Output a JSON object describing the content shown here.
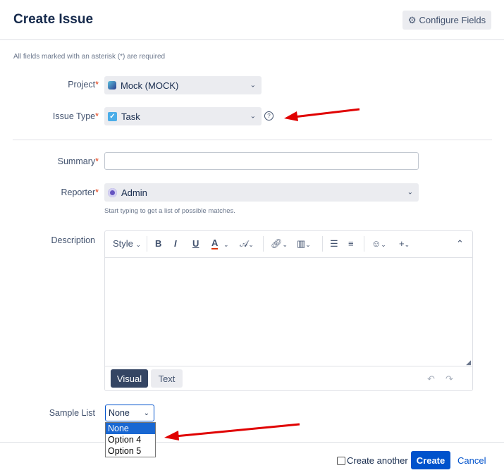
{
  "header": {
    "title": "Create Issue",
    "configure_label": "Configure Fields"
  },
  "required_note": "All fields marked with an asterisk (*) are required",
  "project": {
    "label": "Project",
    "value": "Mock (MOCK)"
  },
  "issue_type": {
    "label": "Issue Type",
    "value": "Task"
  },
  "summary": {
    "label": "Summary",
    "value": ""
  },
  "reporter": {
    "label": "Reporter",
    "value": "Admin",
    "hint": "Start typing to get a list of possible matches."
  },
  "description": {
    "label": "Description",
    "toolbar": {
      "style_label": "Style",
      "bold": "B",
      "italic": "I",
      "underline": "U",
      "text_color": "A"
    },
    "modes": {
      "visual": "Visual",
      "text": "Text"
    }
  },
  "sample_list": {
    "label": "Sample List",
    "selected": "None",
    "options": [
      "None",
      "Option 4",
      "Option 5"
    ]
  },
  "footer": {
    "create_another_label": "Create another",
    "create_label": "Create",
    "cancel_label": "Cancel"
  },
  "colors": {
    "accent": "#0052cc",
    "required": "#de350b",
    "annotation_arrow": "#e00000"
  }
}
